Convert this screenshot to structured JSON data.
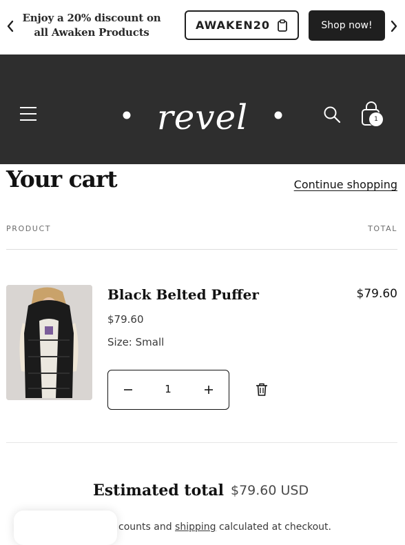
{
  "announcement": {
    "text": "Enjoy a 20% discount on all Awaken Products",
    "code": "AWAKEN20",
    "shop_label": "Shop now!"
  },
  "header": {
    "logo_text": "revel",
    "cart_count": "1"
  },
  "cart": {
    "title": "Your cart",
    "continue_label": "Continue shopping",
    "columns": {
      "product": "PRODUCT",
      "total": "TOTAL"
    },
    "items": [
      {
        "name": "Black Belted Puffer",
        "price": "$79.60",
        "size": "Size: Small",
        "quantity": "1",
        "line_total": "$79.60"
      }
    ]
  },
  "summary": {
    "label": "Estimated total",
    "value": "$79.60 USD",
    "note_prefix": "counts and ",
    "note_link": "shipping",
    "note_suffix": " calculated at checkout."
  }
}
